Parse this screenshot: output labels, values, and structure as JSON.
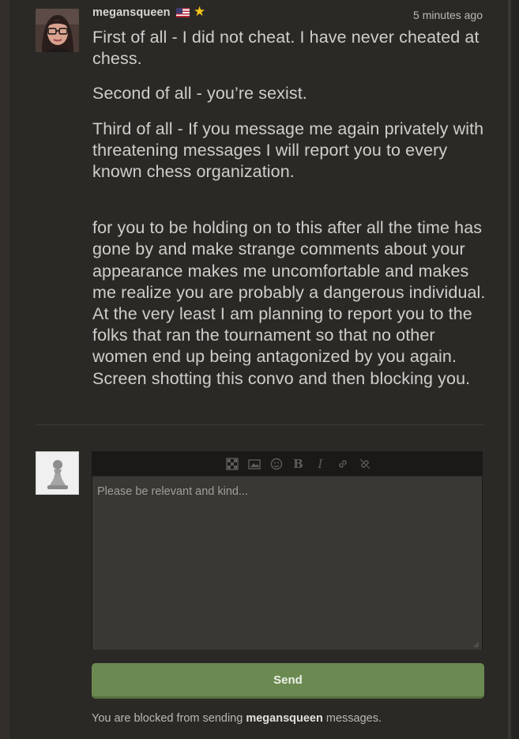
{
  "message": {
    "username": "megansqueen",
    "timestamp": "5 minutes ago",
    "paragraphs": [
      "First of all - I did not cheat. I have never cheated at chess.",
      "Second of all - you’re sexist.",
      "Third of all - If you message me again privately with threatening messages I will report you to every known chess organization.",
      "for you to be holding on to this after all the time has gone by and make strange comments about your appearance makes me uncomfortable and makes me realize you are probably a dangerous individual. At the very least I am planning to report you to the folks that ran the tournament so that no other women end up being antagonized by you again. Screen shotting this convo and then blocking you."
    ]
  },
  "editor": {
    "toolbar": [
      "chessboard-icon",
      "image-icon",
      "emoji-icon",
      "bold-icon",
      "italic-icon",
      "link-icon",
      "unlink-icon"
    ],
    "placeholder": "Please be relevant and kind..."
  },
  "send_label": "Send",
  "blocked_notice": {
    "prefix": "You are blocked from sending",
    "username": "megansqueen",
    "suffix": "messages."
  },
  "colors": {
    "background": "#2b2926",
    "send_button": "#6b8a52",
    "star": "#f5c518"
  }
}
